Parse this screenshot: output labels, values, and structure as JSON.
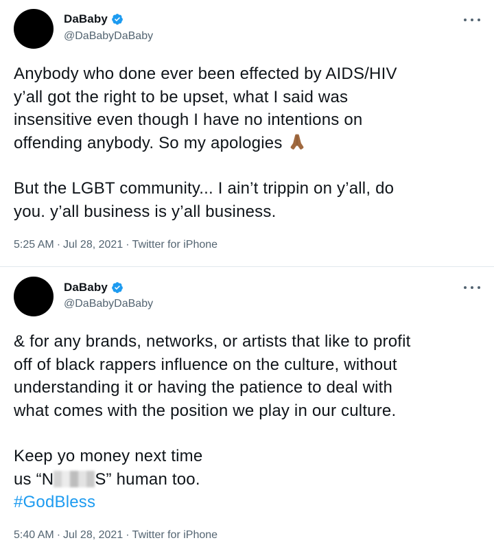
{
  "tweets": [
    {
      "display_name": "DaBaby",
      "handle": "@DaBabyDaBaby",
      "verified_icon": "verified-badge-icon",
      "avatar_color": "#000000",
      "lines": [
        "Anybody who done ever been effected by AIDS/HIV",
        "y’all got the right to be upset, what I said was",
        "insensitive even though I have no intentions on",
        "offending anybody. So my apologies"
      ],
      "lines2": [
        "But the LGBT community... I ain’t trippin on y’all, do",
        "you. y’all business is y’all business."
      ],
      "emoji": "folded-hands-emoji",
      "time": "5:25 AM",
      "date": "Jul 28, 2021",
      "source": "Twitter for iPhone"
    },
    {
      "display_name": "DaBaby",
      "handle": "@DaBabyDaBaby",
      "verified_icon": "verified-badge-icon",
      "avatar_color": "#000000",
      "lines": [
        "& for any brands, networks, or artists that like to profit",
        "off of black rappers influence on the culture, without",
        "understanding it or having the patience to deal with",
        "what comes with the position we play in our culture."
      ],
      "line_keep": "Keep yo money next time",
      "line_us_prefix": "us “N",
      "line_us_suffix": "S” human too.",
      "hashtag": "#GodBless",
      "time": "5:40 AM",
      "date": "Jul 28, 2021",
      "source": "Twitter for iPhone"
    }
  ],
  "colors": {
    "verified": "#1d9bf0",
    "hashtag": "#1d9bf0",
    "meta_gray": "#536471",
    "text": "#0f1419"
  }
}
